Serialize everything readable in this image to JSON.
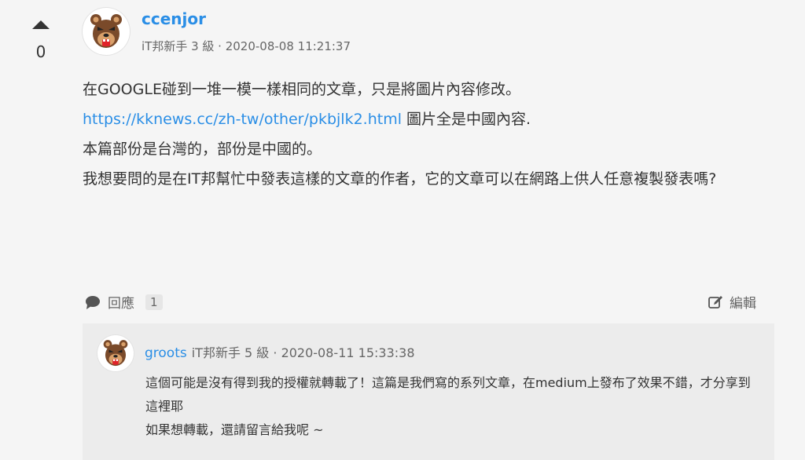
{
  "vote": {
    "count": "0",
    "up_icon": "upvote-arrow-icon"
  },
  "post": {
    "author": "ccenjor",
    "meta": "iT邦新手 3 級 · 2020-08-08 11:21:37",
    "line1": "在GOOGLE碰到一堆一模一樣相同的文章，只是將圖片內容修改。",
    "link": "https://kknews.cc/zh-tw/other/pkbjlk2.html",
    "line2_suffix": " 圖片全是中國內容.",
    "line3": "本篇部份是台灣的，部份是中國的。",
    "line4": "我想要問的是在IT邦幫忙中發表這樣的文章的作者，它的文章可以在網路上供人任意複製發表嗎?"
  },
  "actions": {
    "reply_label": "回應",
    "reply_count": "1",
    "edit_label": "編輯"
  },
  "reply": {
    "author": "groots",
    "meta": "iT邦新手 5 級 · 2020-08-11 15:33:38",
    "line1": "這個可能是沒有得到我的授權就轉載了！這篇是我們寫的系列文章，在medium上發布了效果不錯，才分享到這裡耶",
    "line2": "如果想轉載，還請留言給我呢 ~"
  },
  "colors": {
    "link": "#2a8ee6",
    "text": "#333333",
    "muted": "#666666",
    "background": "#f5f5f5",
    "reply_bg": "#ececec"
  }
}
